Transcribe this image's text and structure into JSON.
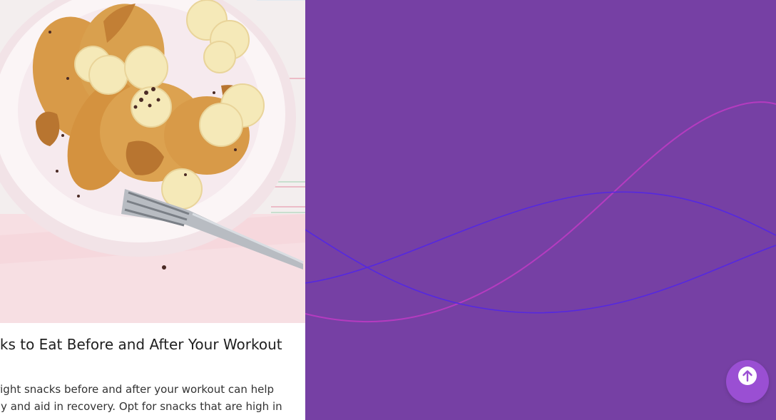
{
  "card": {
    "image_alt": "pancakes with banana slices, nut butter and cacao nibs",
    "title": "hy Snacks to Eat Before and After Your Workout",
    "body_line_1": " right snacks before and after your workout can help",
    "body_line_2": "ody and aid in recovery. Opt for snacks that are high in"
  },
  "panel": {
    "background": "#7640a4",
    "wave_colors": [
      "#b53bc0",
      "#5528e0"
    ]
  },
  "scroll_top_button": {
    "icon": "arrow-up-circle-icon",
    "color": "#9a4fd3"
  }
}
